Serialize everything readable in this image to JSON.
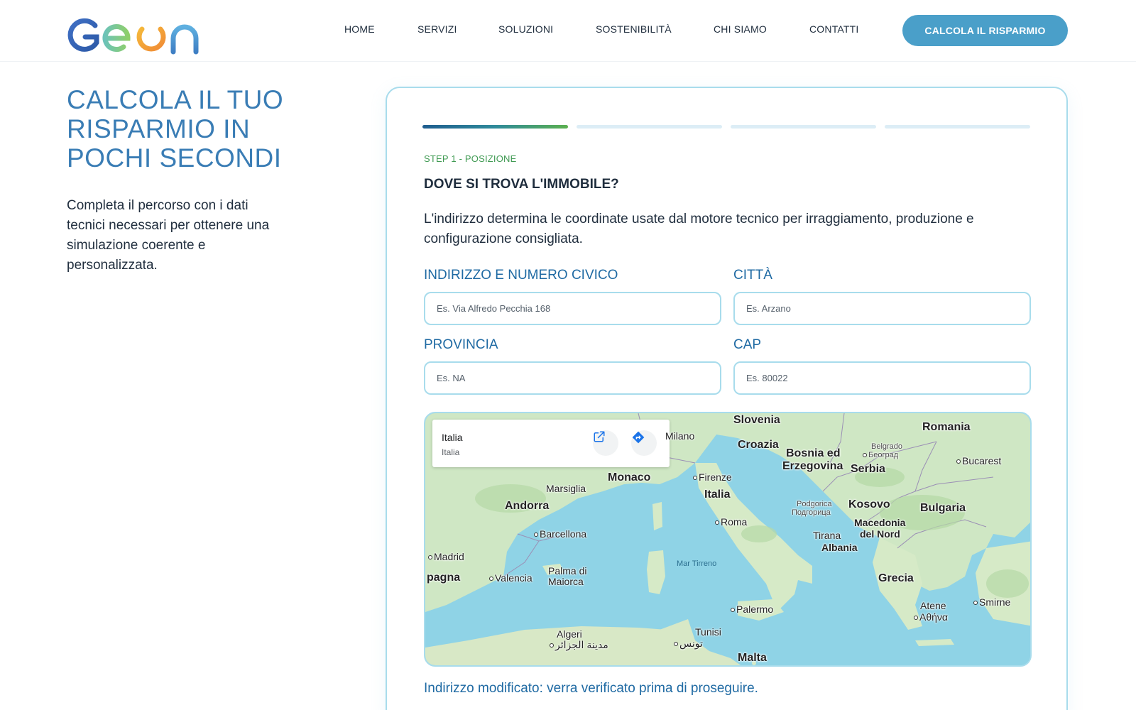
{
  "brand": {
    "logo_text": "Geon",
    "colors": {
      "blue": "#3f6fc4",
      "green": "#7cc36b",
      "orange": "#f2a03d",
      "teal": "#4a9fc9",
      "accent_green": "#3f9a52"
    }
  },
  "nav": {
    "items": [
      {
        "label": "HOME"
      },
      {
        "label": "SERVIZI"
      },
      {
        "label": "SOLUZIONI"
      },
      {
        "label": "SOSTENIBILITÀ"
      },
      {
        "label": "CHI SIAMO"
      },
      {
        "label": "CONTATTI"
      }
    ],
    "cta_label": "CALCOLA IL RISPARMIO"
  },
  "hero": {
    "title": "CALCOLA IL TUO RISPARMIO IN POCHI SECONDI",
    "text": "Completa il percorso con i dati tecnici necessari per ottenere una simulazione coerente e personalizzata."
  },
  "wizard": {
    "total_steps": 4,
    "current_step": 1,
    "step_label": "STEP 1 - POSIZIONE",
    "question": "DOVE SI TROVA L'IMMOBILE?",
    "description": "L'indirizzo determina le coordinate usate dal motore tecnico per irraggiamento, produzione e configurazione consigliata.",
    "fields": {
      "address": {
        "label": "INDIRIZZO E NUMERO CIVICO",
        "placeholder": "Es. Via Alfredo Pecchia 168",
        "value": ""
      },
      "city": {
        "label": "CITTÀ",
        "placeholder": "Es. Arzano",
        "value": ""
      },
      "province": {
        "label": "PROVINCIA",
        "placeholder": "Es. NA",
        "value": ""
      },
      "cap": {
        "label": "CAP",
        "placeholder": "Es. 80022",
        "value": ""
      }
    },
    "status_note": "Indirizzo modificato: verra verificato prima di proseguire."
  },
  "map": {
    "place_card": {
      "name": "Italia",
      "subtitle": "Italia",
      "open_icon": "open-in-new-icon",
      "directions_icon": "directions-icon"
    },
    "labels": {
      "slovenia": "Slovenia",
      "romania": "Romania",
      "milano": "Milano",
      "croazia": "Croazia",
      "belgrado": "Belgrado",
      "beograd": "Београд",
      "bosnia1": "Bosnia ed",
      "bosnia2": "Erzegovina",
      "serbia": "Serbia",
      "bucarest": "Bucarest",
      "monaco": "Monaco",
      "firenze": "Firenze",
      "marsiglia": "Marsiglia",
      "italia": "Italia",
      "andorra": "Andorra",
      "podgorica": "Podgorica",
      "podgorica_cyr": "Подгорица",
      "kosovo": "Kosovo",
      "bulgaria": "Bulgaria",
      "roma": "Roma",
      "macedonia1": "Macedonia",
      "macedonia2": "del Nord",
      "barcellona": "Barcellona",
      "tirana": "Tirana",
      "albania": "Albania",
      "madrid": "Madrid",
      "mar_tirreno": "Mar Tirreno",
      "palma1": "Palma di",
      "palma2": "Maiorca",
      "spagna": "pagna",
      "valencia": "Valencia",
      "grecia": "Grecia",
      "smirne": "Smirne",
      "atene": "Atene",
      "athina": "Αθήνα",
      "palermo": "Palermo",
      "algeri": "Algeri",
      "algeri_ar": "مدينة الجزائر",
      "tunisi": "Tunisi",
      "tunisi_ar": "تونس",
      "malta": "Malta"
    }
  }
}
